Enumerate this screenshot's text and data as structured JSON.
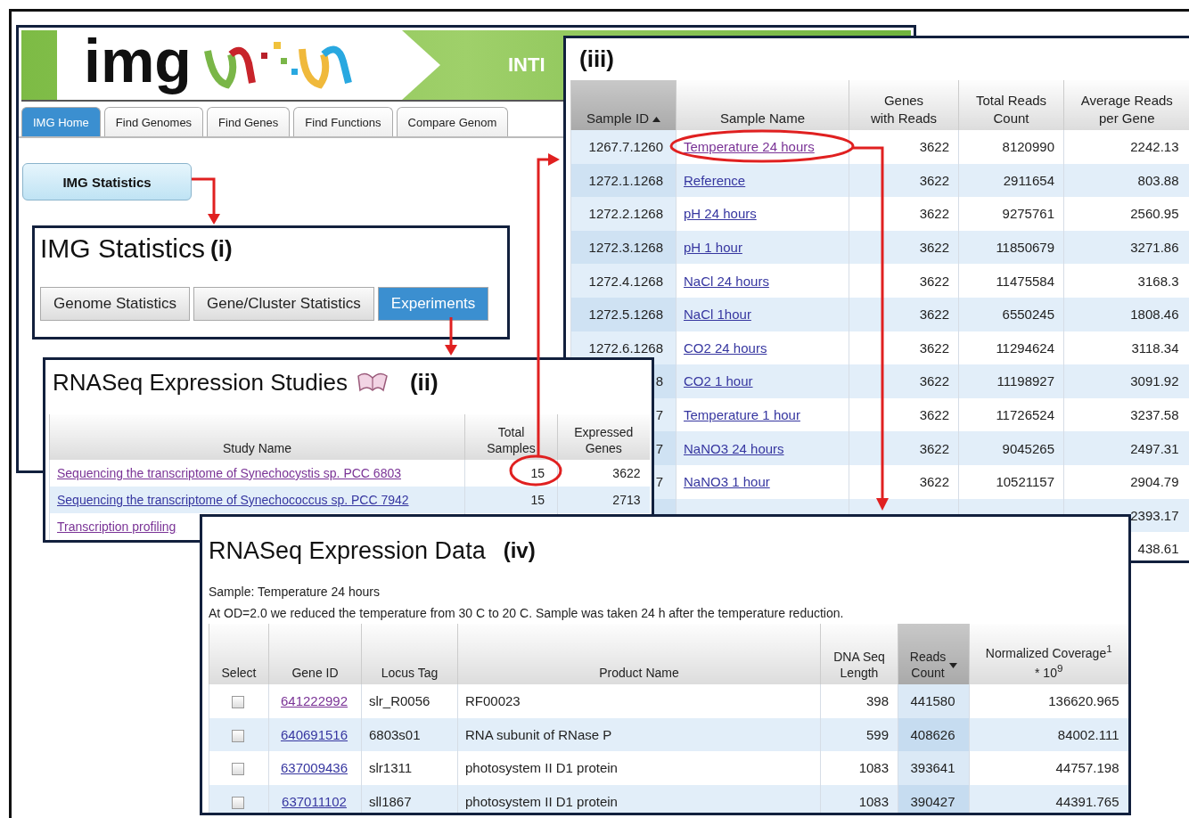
{
  "main_window": {
    "logo": "img",
    "banner_text": "INTI",
    "tabs": [
      {
        "label": "IMG Home",
        "selected": true
      },
      {
        "label": "Find Genomes",
        "selected": false
      },
      {
        "label": "Find Genes",
        "selected": false
      },
      {
        "label": "Find Functions",
        "selected": false
      },
      {
        "label": "Compare Genom",
        "selected": false
      }
    ],
    "stats_button": "IMG Statistics"
  },
  "panel_i": {
    "title": "IMG Statistics",
    "label": "(i)",
    "tabs": [
      {
        "label": "Genome Statistics",
        "selected": false
      },
      {
        "label": "Gene/Cluster Statistics",
        "selected": false
      },
      {
        "label": "Experiments",
        "selected": true
      }
    ]
  },
  "panel_iii": {
    "label": "(iii)",
    "sort_ascending": true,
    "columns": [
      {
        "label": "Sample ID",
        "sorted": true
      },
      {
        "label": "Sample Name",
        "sorted": false
      },
      {
        "label": "Genes\nwith Reads",
        "sorted": false
      },
      {
        "label": "Total Reads\nCount",
        "sorted": false
      },
      {
        "label": "Average Reads\nper Gene",
        "sorted": false
      }
    ],
    "rows": [
      {
        "sample_id": "1267.7.1260",
        "sample_name": "Temperature 24 hours",
        "visited": true,
        "genes": "3622",
        "total_reads": "8120990",
        "avg_reads": "2242.13"
      },
      {
        "sample_id": "1272.1.1268",
        "sample_name": "Reference",
        "visited": false,
        "genes": "3622",
        "total_reads": "2911654",
        "avg_reads": "803.88"
      },
      {
        "sample_id": "1272.2.1268",
        "sample_name": "pH 24 hours",
        "visited": false,
        "genes": "3622",
        "total_reads": "9275761",
        "avg_reads": "2560.95"
      },
      {
        "sample_id": "1272.3.1268",
        "sample_name": "pH 1 hour",
        "visited": false,
        "genes": "3622",
        "total_reads": "11850679",
        "avg_reads": "3271.86"
      },
      {
        "sample_id": "1272.4.1268",
        "sample_name": "NaCl 24 hours",
        "visited": false,
        "genes": "3622",
        "total_reads": "11475584",
        "avg_reads": "3168.3"
      },
      {
        "sample_id": "1272.5.1268",
        "sample_name": "NaCl 1hour",
        "visited": false,
        "genes": "3622",
        "total_reads": "6550245",
        "avg_reads": "1808.46"
      },
      {
        "sample_id": "1272.6.1268",
        "sample_name": "CO2 24 hours",
        "visited": false,
        "genes": "3622",
        "total_reads": "11294624",
        "avg_reads": "3118.34"
      },
      {
        "sample_id": "8",
        "sample_name": "CO2 1 hour",
        "visited": false,
        "genes": "3622",
        "total_reads": "11198927",
        "avg_reads": "3091.92"
      },
      {
        "sample_id": "7",
        "sample_name": "Temperature 1 hour",
        "visited": false,
        "genes": "3622",
        "total_reads": "11726524",
        "avg_reads": "3237.58"
      },
      {
        "sample_id": "7",
        "sample_name": "NaNO3 24 hours",
        "visited": false,
        "genes": "3622",
        "total_reads": "9045265",
        "avg_reads": "2497.31"
      },
      {
        "sample_id": "7",
        "sample_name": "NaNO3 1 hour",
        "visited": false,
        "genes": "3622",
        "total_reads": "10521157",
        "avg_reads": "2904.79"
      },
      {
        "avg_reads": "2393.17"
      },
      {
        "avg_reads": "438.61"
      }
    ]
  },
  "panel_ii": {
    "title": "RNASeq Expression Studies",
    "label": "(ii)",
    "columns": [
      "Study Name",
      "Total\nSamples",
      "Expressed\nGenes"
    ],
    "rows": [
      {
        "study_name": "Sequencing the transcriptome of Synechocystis sp. PCC 6803",
        "visited": true,
        "total_samples": "15",
        "expressed_genes": "3622"
      },
      {
        "study_name": "Sequencing the transcriptome of Synechococcus sp. PCC 7942",
        "visited": false,
        "total_samples": "15",
        "expressed_genes": "2713"
      },
      {
        "study_name": "Transcription profiling",
        "visited": true
      }
    ]
  },
  "panel_iv": {
    "title": "RNASeq Expression Data",
    "label": "(iv)",
    "sample": "Sample: Temperature 24 hours",
    "description": "At OD=2.0 we reduced the temperature from 30 C to 20 C. Sample was taken 24 h after the temperature reduction.",
    "sort_ascending": false,
    "columns": [
      {
        "label": "Select",
        "sorted": false
      },
      {
        "label": "Gene ID",
        "sorted": false
      },
      {
        "label": "Locus Tag",
        "sorted": false
      },
      {
        "label": "Product Name",
        "sorted": false
      },
      {
        "label": "DNA Seq\nLength",
        "sorted": false
      },
      {
        "label": "Reads\nCount",
        "sorted": true
      },
      {
        "label": "Normalized Coverage$^{1}$\n* 10$^{9}$",
        "sorted": false
      }
    ],
    "rows": [
      {
        "checked": false,
        "gene_id": "641222992",
        "visited": true,
        "locus_tag": "slr_R0056",
        "product": "RF00023",
        "length": "398",
        "reads": "441580",
        "coverage": "136620.965"
      },
      {
        "checked": false,
        "gene_id": "640691516",
        "visited": false,
        "locus_tag": "6803s01",
        "product": "RNA subunit of RNase P",
        "length": "599",
        "reads": "408626",
        "coverage": "84002.111"
      },
      {
        "checked": false,
        "gene_id": "637009436",
        "visited": false,
        "locus_tag": "slr1311",
        "product": "photosystem II D1 protein",
        "length": "1083",
        "reads": "393641",
        "coverage": "44757.198"
      },
      {
        "checked": false,
        "gene_id": "637011102",
        "visited": false,
        "locus_tag": "sll1867",
        "product": "photosystem II D1 protein",
        "length": "1083",
        "reads": "390427",
        "coverage": "44391.765"
      }
    ]
  }
}
